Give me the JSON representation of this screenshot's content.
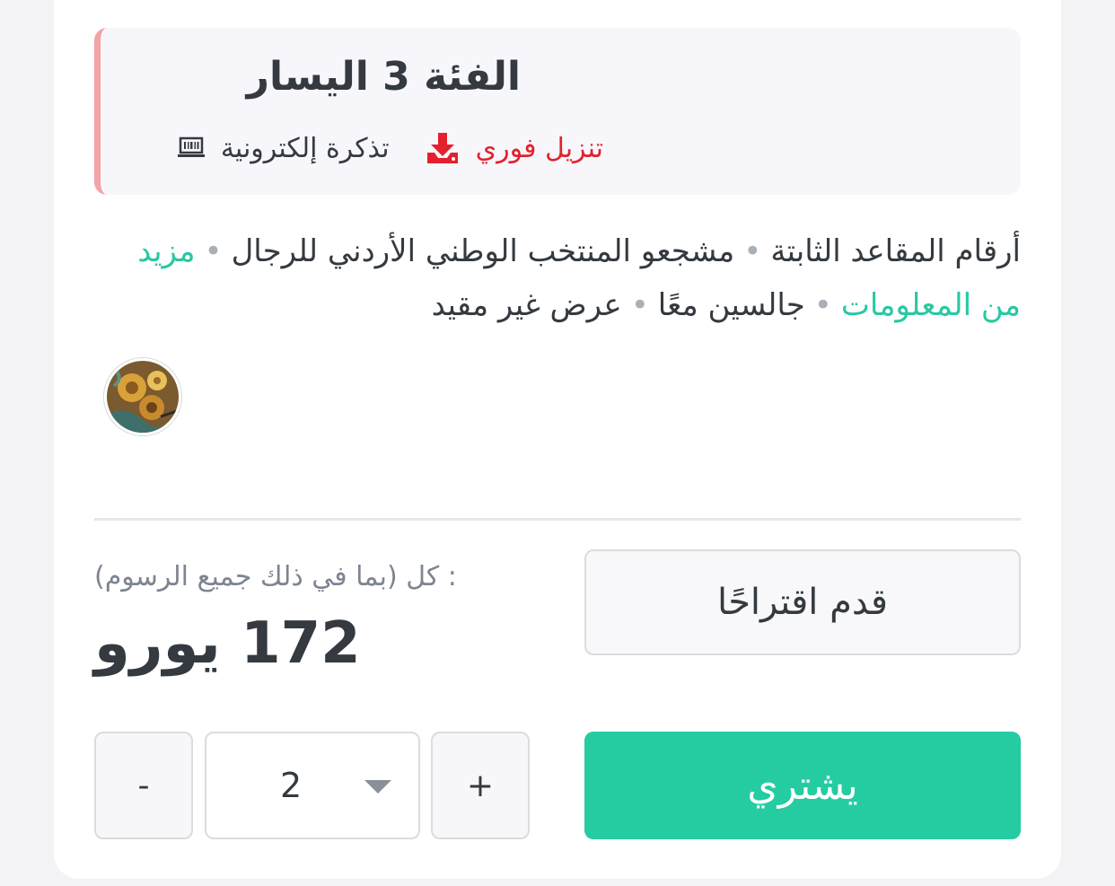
{
  "category": {
    "title": "الفئة 3 اليسار",
    "download_label": "تنزيل فوري",
    "download_icon": "download-icon",
    "eticket_label": "تذكرة إلكترونية",
    "eticket_icon": "barcode-ticket-icon",
    "accent_color": "#f4a3a6",
    "download_color": "#e4202e"
  },
  "description": {
    "items": [
      "أرقام المقاعد الثابتة",
      "مشجعو المنتخب الوطني الأردني للرجال",
      "مزيد من المعلومات",
      "جالسين معًا",
      "عرض غير مقيد"
    ],
    "link_color": "#28c8a3"
  },
  "seller": {
    "avatar": "seller-avatar-image"
  },
  "pricing": {
    "label": ": كل  (بما في ذلك جميع الرسوم)",
    "price": "172 يورو"
  },
  "actions": {
    "suggest_label": "قدم اقتراحًا",
    "buy_label": "يشتري",
    "buy_color": "#25cca2"
  },
  "quantity": {
    "minus_label": "-",
    "plus_label": "+",
    "value": "2"
  }
}
